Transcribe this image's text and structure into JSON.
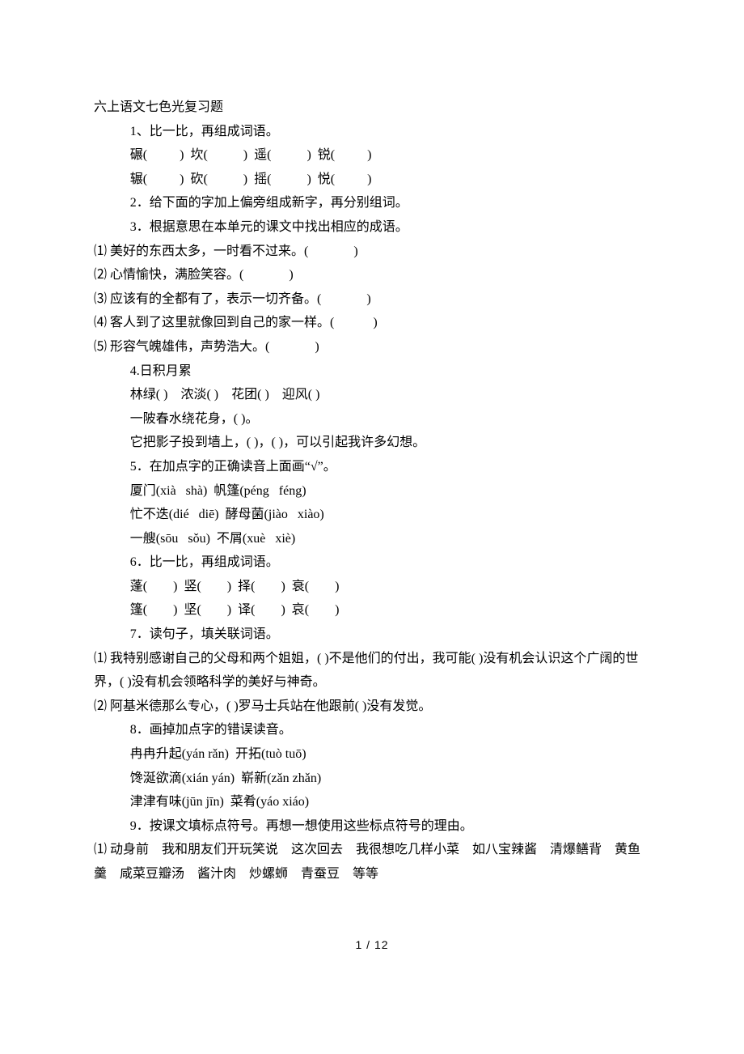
{
  "title": "六上语文七色光复习题",
  "lines": [
    {
      "cls": "indent",
      "text": "1、比一比，再组成词语。"
    },
    {
      "cls": "indent",
      "text": "碾(          )  坎(           )  遥(           )  锐(          )"
    },
    {
      "cls": "indent",
      "text": "辗(          )  砍(           )  摇(           )  悦(          )"
    },
    {
      "cls": "indent",
      "text": "2．给下面的字加上偏旁组成新字，再分别组词。"
    },
    {
      "cls": "indent",
      "text": "3．根据意思在本单元的课文中找出相应的成语。"
    },
    {
      "cls": "",
      "text": "⑴ 美好的东西太多，一时看不过来。(              )"
    },
    {
      "cls": "",
      "text": "⑵ 心情愉快，满脸笑容。(              )"
    },
    {
      "cls": "",
      "text": "⑶ 应该有的全都有了，表示一切齐备。(              )"
    },
    {
      "cls": "",
      "text": "⑷ 客人到了这里就像回到自己的家一样。(            )"
    },
    {
      "cls": "",
      "text": "⑸ 形容气魄雄伟，声势浩大。(              )"
    },
    {
      "cls": "indent",
      "text": "4.日积月累"
    },
    {
      "cls": "indent",
      "text": "林绿( )    浓淡( )    花团( )    迎风( )"
    },
    {
      "cls": "indent",
      "text": "一陂春水绕花身，( )。"
    },
    {
      "cls": "indent",
      "text": "它把影子投到墙上，( )，( )，可以引起我许多幻想。"
    },
    {
      "cls": "indent",
      "text": "5．在加点字的正确读音上面画“√”。"
    },
    {
      "cls": "indent",
      "text": "厦门(xià   shà)  帆篷(péng   féng)"
    },
    {
      "cls": "indent",
      "text": "忙不迭(dié   diē)  酵母菌(jiào   xiào)"
    },
    {
      "cls": "indent",
      "text": "一艘(sōu   sǒu)  不屑(xuè   xiè)"
    },
    {
      "cls": "indent",
      "text": "6．比一比，再组成词语。"
    },
    {
      "cls": "indent",
      "text": "蓬(        )  竖(        )  择(        )  衰(        )"
    },
    {
      "cls": "indent",
      "text": "篷(        )  坚(        )  译(        )  哀(        )"
    },
    {
      "cls": "indent",
      "text": "7．读句子，填关联词语。"
    },
    {
      "cls": "",
      "text": "⑴ 我特别感谢自己的父母和两个姐姐，( )不是他们的付出，我可能( )没有机会认识这个广阔的世界，( )没有机会领略科学的美好与神奇。"
    },
    {
      "cls": "",
      "text": "⑵ 阿基米德那么专心，( )罗马士兵站在他跟前( )没有发觉。"
    },
    {
      "cls": "indent",
      "text": "8．画掉加点字的错误读音。"
    },
    {
      "cls": "indent",
      "text": "冉冉升起(yán rǎn)  开拓(tuò tuō)"
    },
    {
      "cls": "indent",
      "text": "馋涎欲滴(xián yán)  崭新(zǎn zhǎn)"
    },
    {
      "cls": "indent",
      "text": "津津有味(jūn jīn)  菜肴(yáo xiáo)"
    },
    {
      "cls": "indent",
      "text": "9．按课文填标点符号。再想一想使用这些标点符号的理由。"
    },
    {
      "cls": "",
      "text": "⑴ 动身前    我和朋友们开玩笑说    这次回去    我很想吃几样小菜    如八宝辣酱    清爆鳝背    黄鱼羹    咸菜豆瓣汤    酱汁肉    炒螺蛳    青蚕豆    等等"
    }
  ],
  "footer": "1  /  12"
}
